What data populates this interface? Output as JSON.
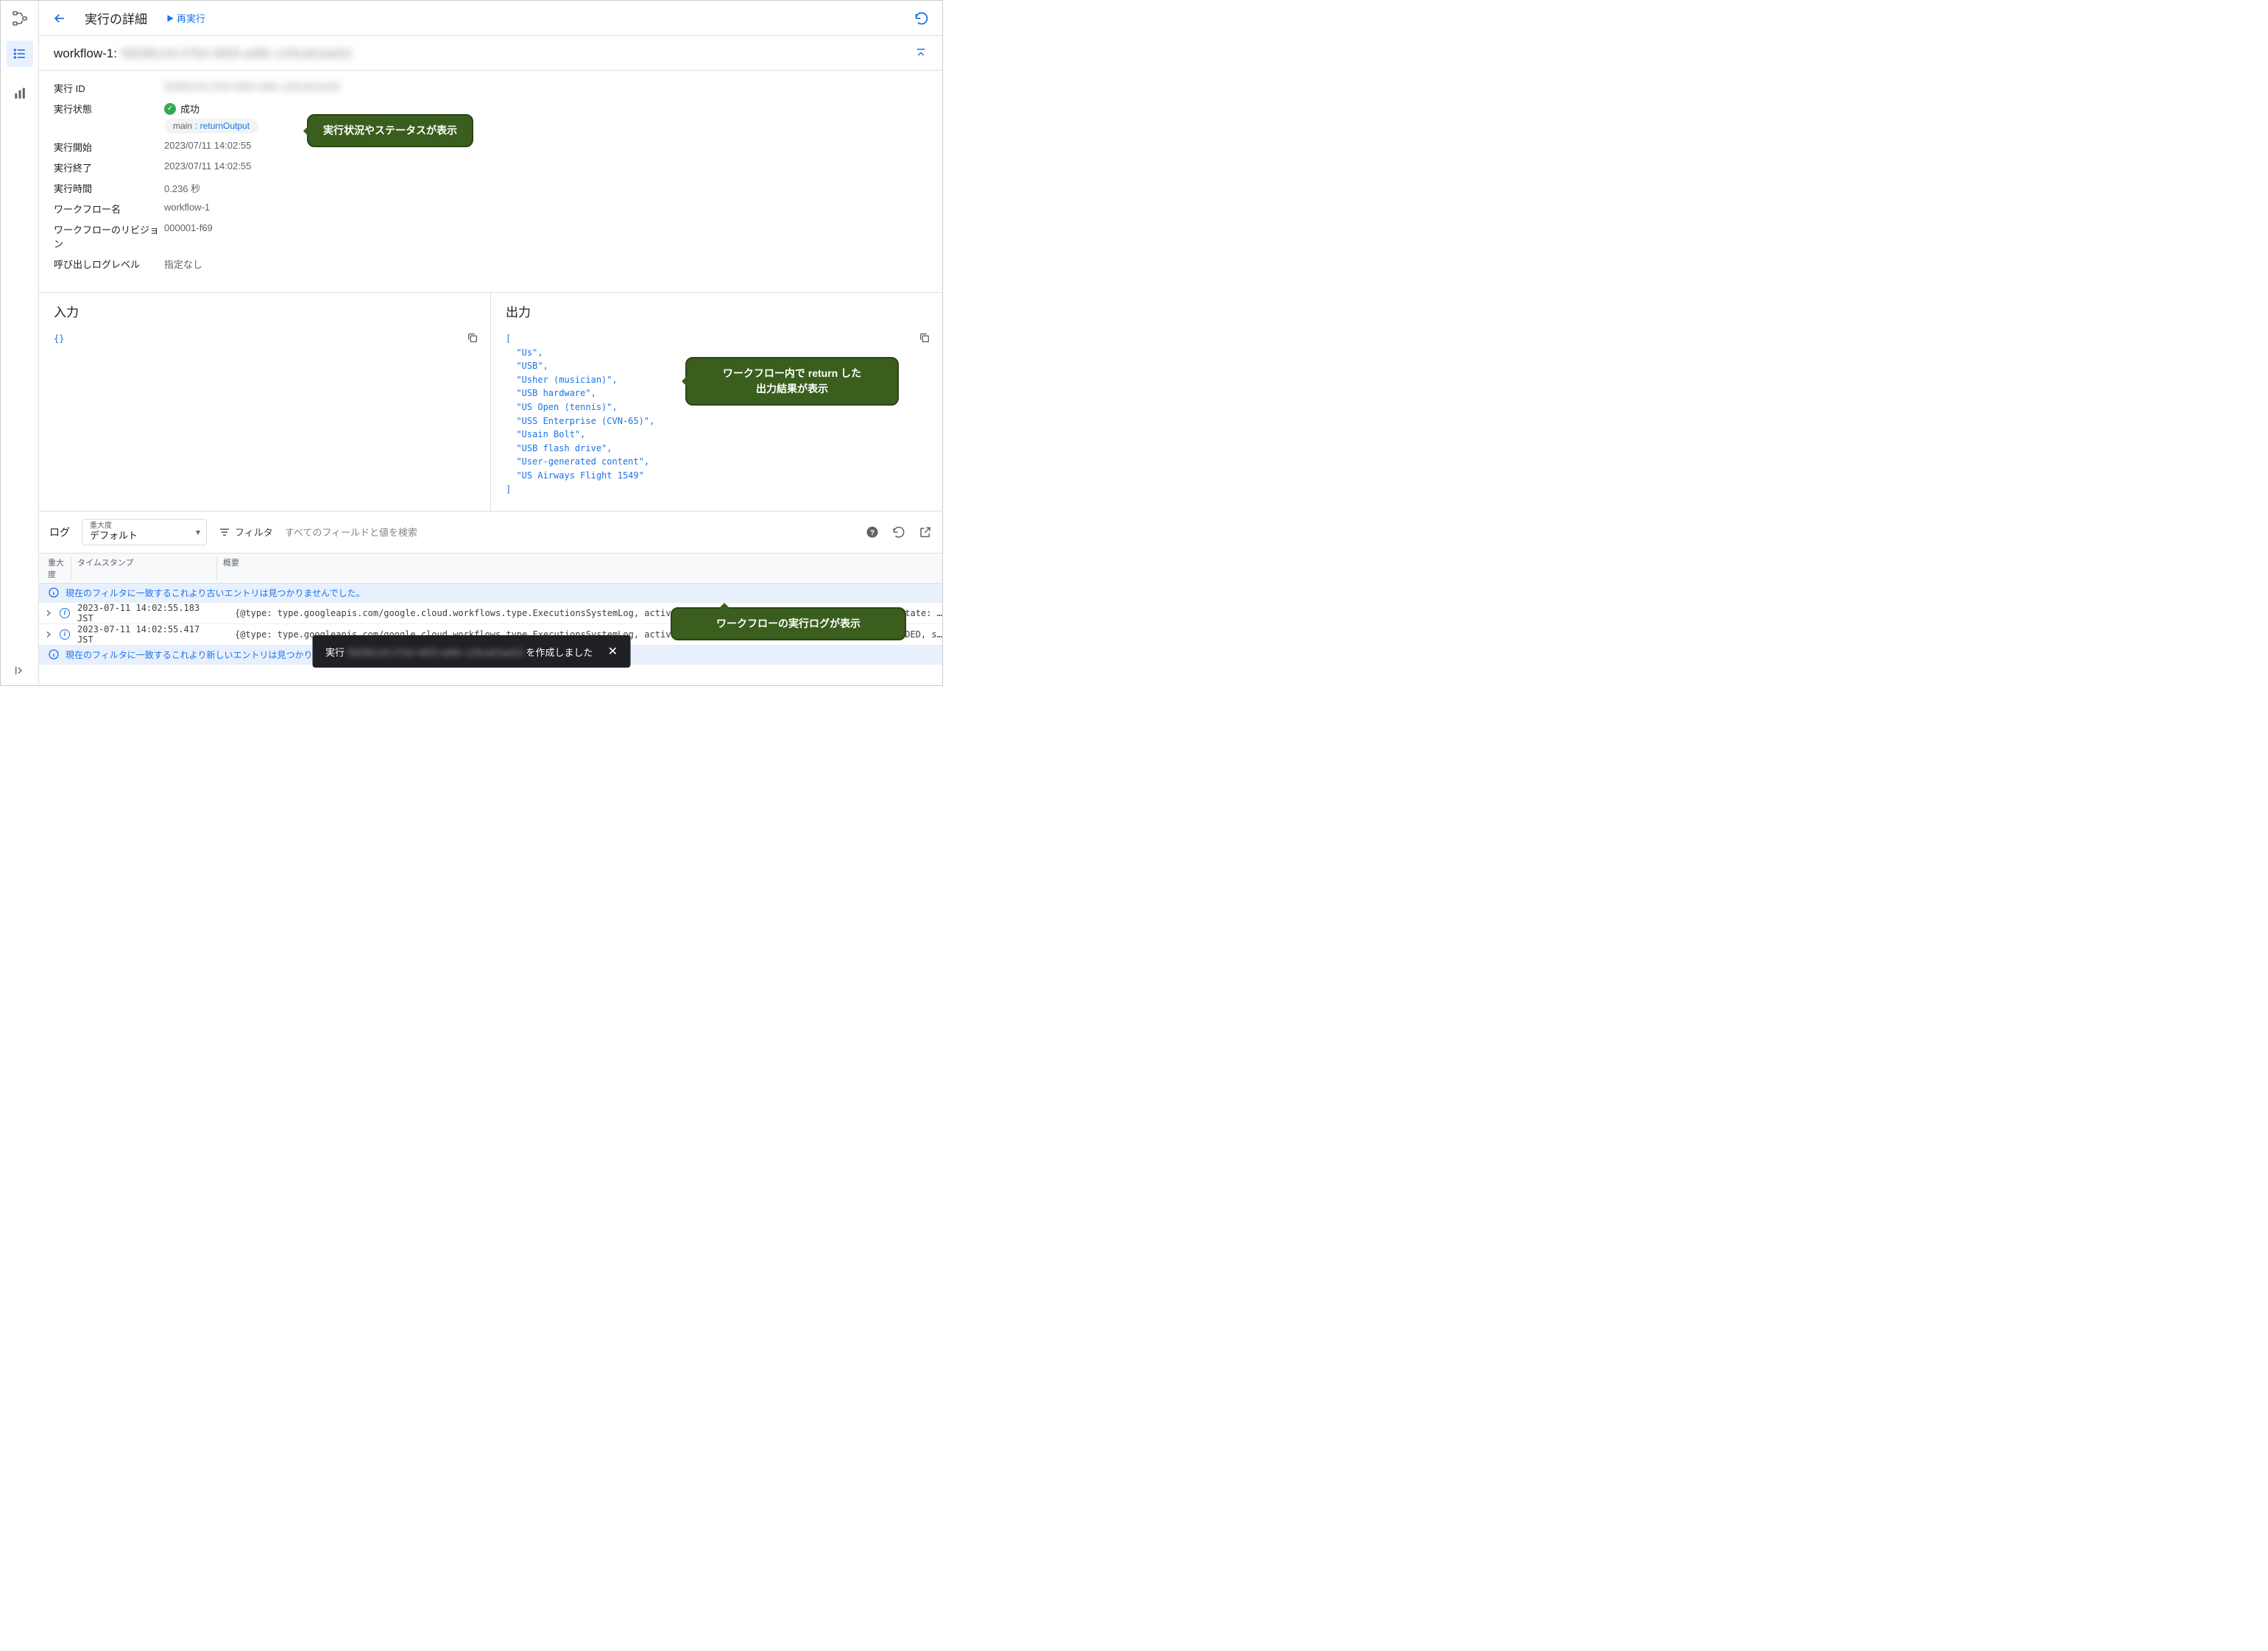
{
  "topbar": {
    "title": "実行の詳細",
    "rerun": "再実行"
  },
  "workflow": {
    "name_label": "workflow-1:",
    "name_id_blur": "59295c23-27b3-4925-a08c-125ca01ae52"
  },
  "details": {
    "exec_id_label": "実行 ID",
    "exec_id_value_blur": "59295c23-27b3-4925-a08c-125ca01ae52",
    "status_label": "実行状態",
    "status_value": "成功",
    "chip_main": "main",
    "chip_return": ": returnOutput",
    "start_label": "実行開始",
    "start_value": "2023/07/11 14:02:55",
    "end_label": "実行終了",
    "end_value": "2023/07/11 14:02:55",
    "duration_label": "実行時間",
    "duration_value": "0.236 秒",
    "wf_name_label": "ワークフロー名",
    "wf_name_value": "workflow-1",
    "revision_label": "ワークフローのリビジョン",
    "revision_value": "000001-f69",
    "log_level_label": "呼び出しログレベル",
    "log_level_value": "指定なし"
  },
  "io": {
    "input_title": "入力",
    "output_title": "出力",
    "input_body": "{}",
    "output_body": "[\n  \"Us\",\n  \"USB\",\n  \"Usher (musician)\",\n  \"USB hardware\",\n  \"US Open (tennis)\",\n  \"USS Enterprise (CVN-65)\",\n  \"Usain Bolt\",\n  \"USB flash drive\",\n  \"User-generated content\",\n  \"US Airways Flight 1549\"\n]"
  },
  "logbar": {
    "label": "ログ",
    "severity_small": "重大度",
    "severity_value": "デフォルト",
    "filter_label": "フィルタ",
    "filter_placeholder": "すべてのフィールドと値を検索"
  },
  "logtable": {
    "head_severity": "重大度",
    "head_timestamp": "タイムスタンプ",
    "head_summary": "概要",
    "info_older": "現在のフィルタに一致するこれより古いエントリは見つかりませんでした。",
    "info_newer": "現在のフィルタに一致するこれより新しいエントリは見つかりませんでした。",
    "rows": [
      {
        "ts": "2023-07-11 14:02:55.183 JST",
        "summary": "{@type: type.googleapis.com/google.cloud.workflows.type.ExecutionsSystemLog, activityTime: 2023-07-11T05:02:55Z, start: {…}, state: ACTIVE}"
      },
      {
        "ts": "2023-07-11 14:02:55.417 JST",
        "summary": "{@type: type.googleapis.com/google.cloud.workflows.type.ExecutionsSystemLog, activityTime: 2023-07-11T05:02:55Z, state: SUCCEEDED, success: {…}}"
      }
    ]
  },
  "callouts": {
    "c1": "実行状況やステータスが表示",
    "c2": "ワークフロー内で return した\n出力結果が表示",
    "c3": "ワークフローの実行ログが表示"
  },
  "toast": {
    "prefix": "実行",
    "blur": "59295c23-27b3-4925-a08c-125ca01ae52",
    "suffix": "を作成しました"
  }
}
